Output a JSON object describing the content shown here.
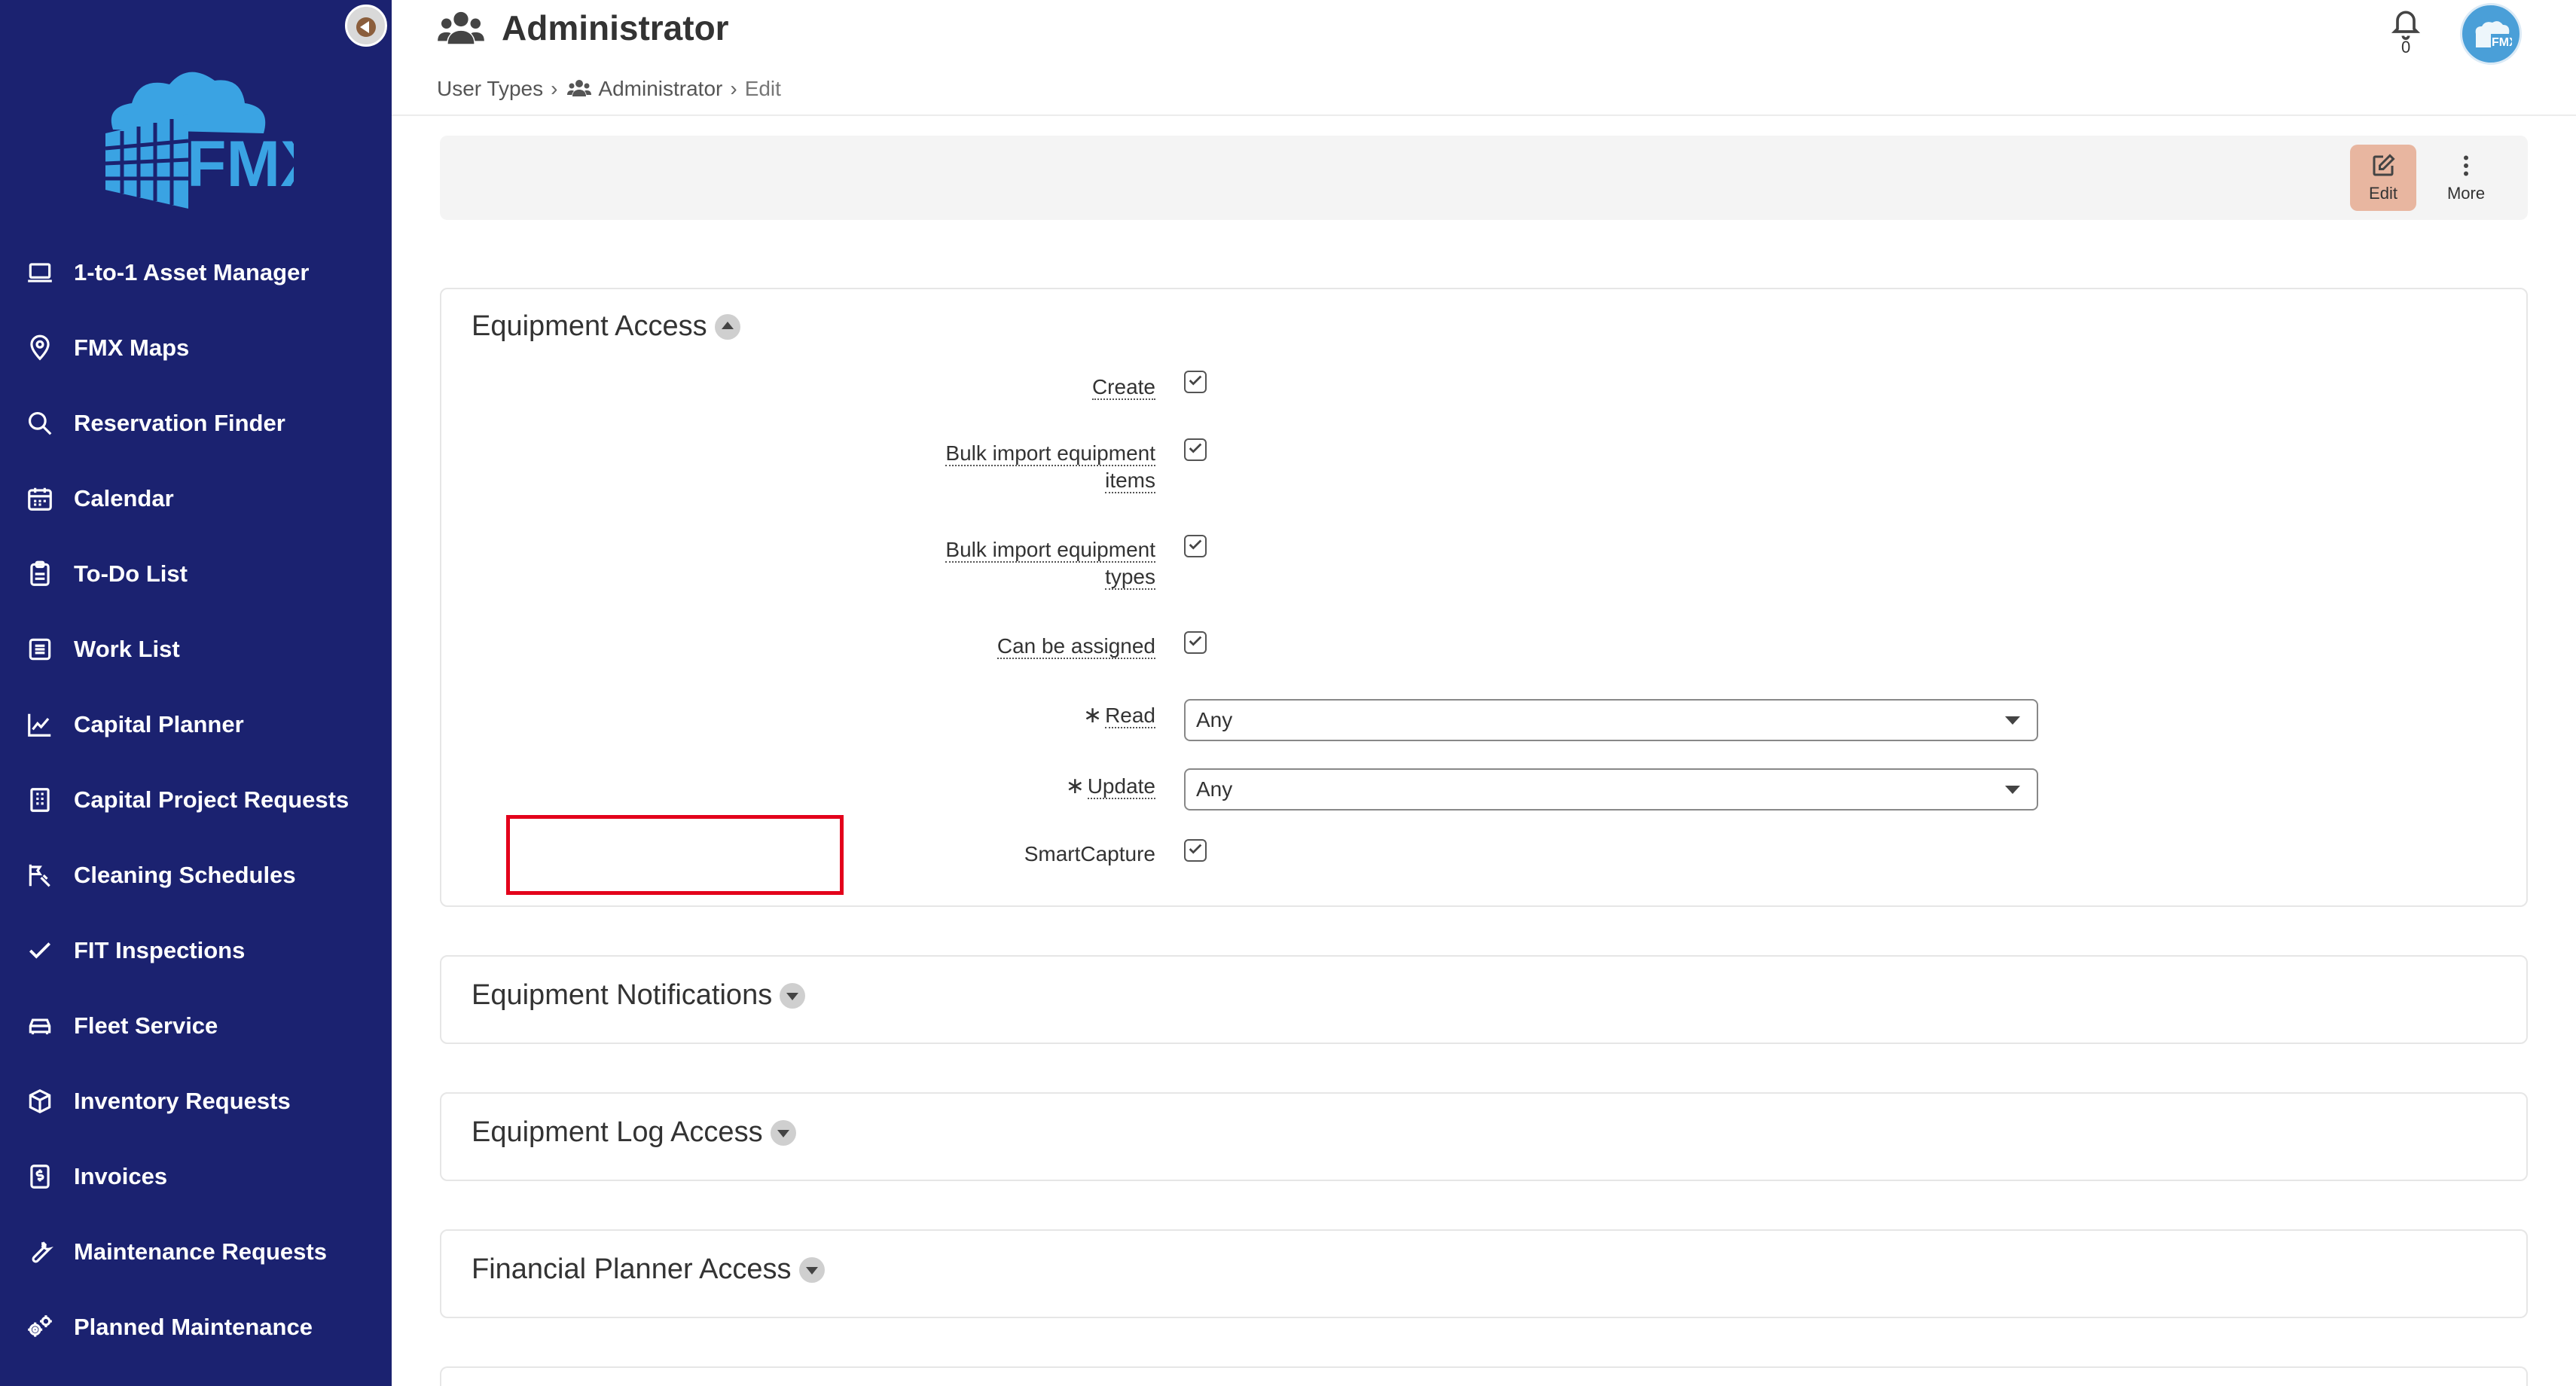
{
  "header": {
    "title": "Administrator",
    "breadcrumb": {
      "item1": "User Types",
      "item2": "Administrator",
      "current": "Edit"
    },
    "notifications_count": "0"
  },
  "toolbar": {
    "edit_label": "Edit",
    "more_label": "More"
  },
  "logo_text": "FMX",
  "sidebar": {
    "items": [
      {
        "label": "1-to-1 Asset Manager",
        "icon": "laptop-icon"
      },
      {
        "label": "FMX Maps",
        "icon": "map-pin-icon"
      },
      {
        "label": "Reservation Finder",
        "icon": "search-icon"
      },
      {
        "label": "Calendar",
        "icon": "calendar-icon"
      },
      {
        "label": "To-Do List",
        "icon": "clipboard-icon"
      },
      {
        "label": "Work List",
        "icon": "list-icon"
      },
      {
        "label": "Capital Planner",
        "icon": "chart-line-icon"
      },
      {
        "label": "Capital Project Requests",
        "icon": "building-icon"
      },
      {
        "label": "Cleaning Schedules",
        "icon": "broom-icon"
      },
      {
        "label": "FIT Inspections",
        "icon": "checkmark-icon"
      },
      {
        "label": "Fleet Service",
        "icon": "car-icon"
      },
      {
        "label": "Inventory Requests",
        "icon": "box-icon"
      },
      {
        "label": "Invoices",
        "icon": "invoice-icon"
      },
      {
        "label": "Maintenance Requests",
        "icon": "wrench-icon"
      },
      {
        "label": "Planned Maintenance",
        "icon": "gears-icon"
      }
    ]
  },
  "sections": {
    "equipment_access": {
      "title": "Equipment Access",
      "fields": {
        "create": "Create",
        "bulk_import_items_line1": "Bulk import equipment",
        "bulk_import_items_line2": "items",
        "bulk_import_types_line1": "Bulk import equipment",
        "bulk_import_types_line2": "types",
        "can_be_assigned": "Can be assigned",
        "read_label": "Read",
        "read_value": "Any",
        "update_label": "Update",
        "update_value": "Any",
        "smartcapture": "SmartCapture"
      },
      "required_marker": "∗"
    },
    "equipment_notifications": {
      "title": "Equipment Notifications"
    },
    "equipment_log_access": {
      "title": "Equipment Log Access"
    },
    "financial_planner_access": {
      "title": "Financial Planner Access"
    }
  },
  "colors": {
    "sidebar_bg": "#1b2270",
    "edit_button_bg": "#e8b6a0",
    "highlight_border": "#e3001b",
    "logo_blue": "#3aa3e3"
  }
}
